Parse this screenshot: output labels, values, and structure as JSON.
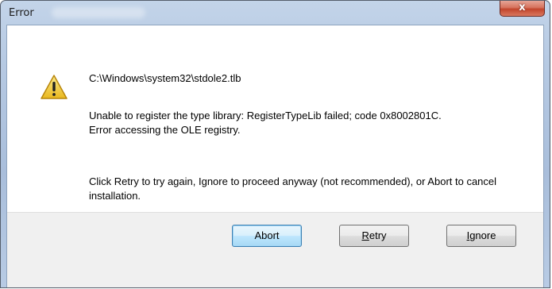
{
  "window": {
    "title": "Error",
    "close_glyph": "x"
  },
  "message": {
    "icon": "warning-icon",
    "path": "C:\\Windows\\system32\\stdole2.tlb",
    "error_line1": "Unable to register the type library: RegisterTypeLib failed; code 0x8002801C.",
    "error_line2": "Error accessing the OLE registry.",
    "advice": "Click Retry to try again, Ignore to proceed anyway (not recommended), or Abort to cancel installation."
  },
  "buttons": {
    "abort": "Abort",
    "retry_first": "R",
    "retry_rest": "etry",
    "ignore_first": "I",
    "ignore_rest": "gnore"
  },
  "colors": {
    "warning_fill": "#f5d23c",
    "close_button": "#c2452c",
    "default_button_border": "#3c7fb1"
  }
}
